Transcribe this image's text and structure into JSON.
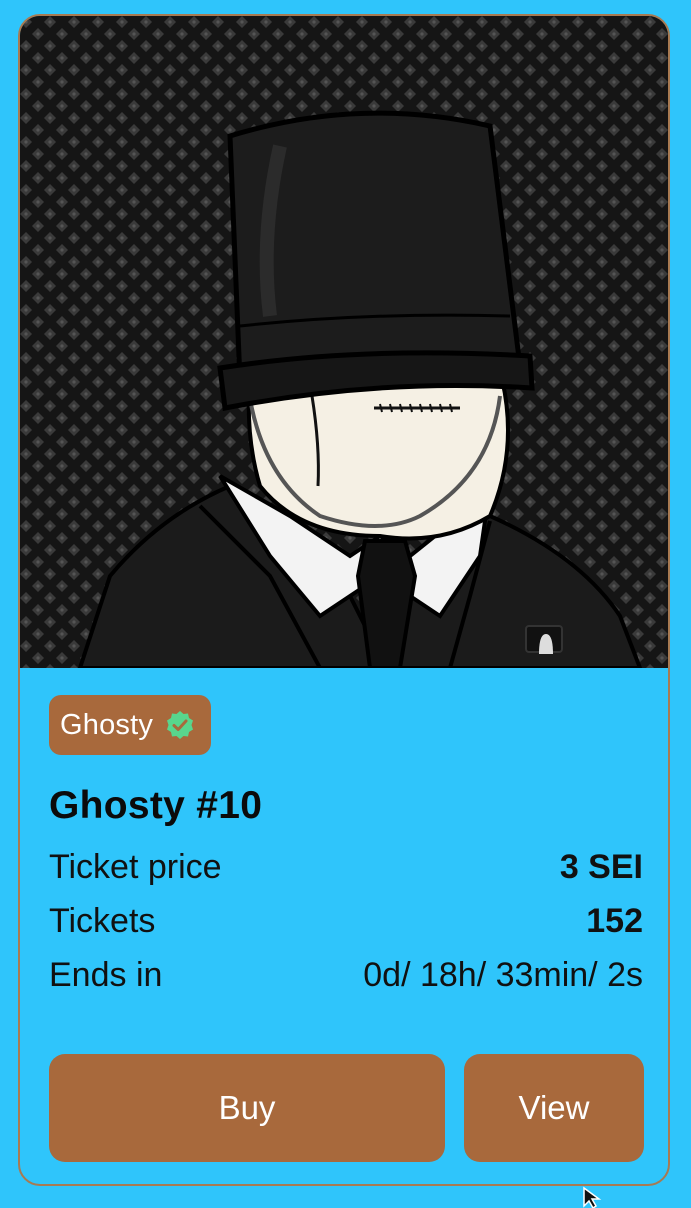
{
  "collection": {
    "name": "Ghosty",
    "verified_icon": "verified-check-icon",
    "verified_color": "#58d68d"
  },
  "nft": {
    "title": "Ghosty #10",
    "image_alt": "Ghosty #10 artwork"
  },
  "details": {
    "price_label": "Ticket price",
    "price_value": "3 SEI",
    "tickets_label": "Tickets",
    "tickets_value": "152",
    "ends_label": "Ends in",
    "ends_value": "0d/ 18h/ 33min/ 2s"
  },
  "actions": {
    "buy_label": "Buy",
    "view_label": "View"
  },
  "colors": {
    "background": "#2fc5fb",
    "button": "#a8693c",
    "card_border": "#a77a52",
    "art_background": "#151515"
  }
}
